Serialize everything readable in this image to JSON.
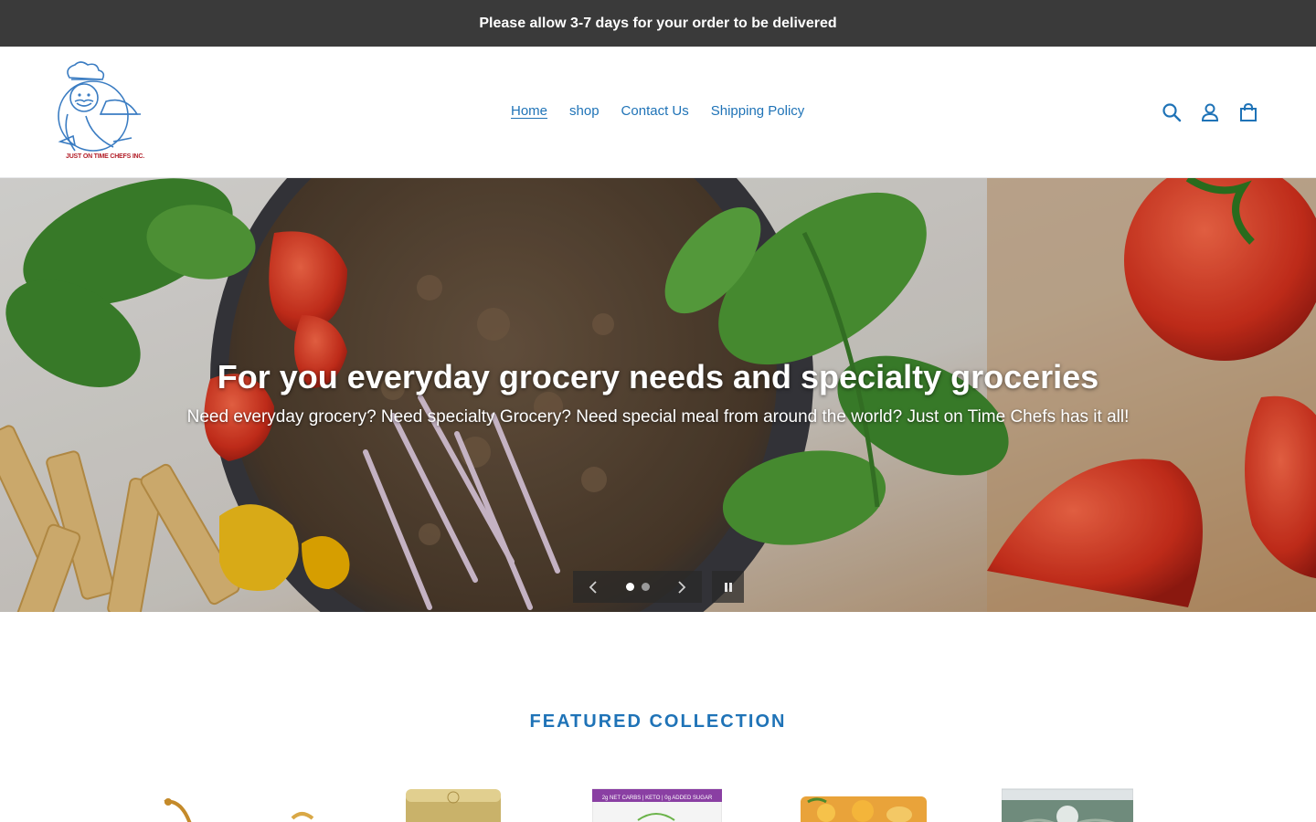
{
  "announcement": {
    "text": "Please allow 3-7 days for your order to be delivered"
  },
  "header": {
    "logo_text": "JUST ON TIME CHEFS INC.",
    "nav": [
      {
        "label": "Home",
        "active": true
      },
      {
        "label": "shop",
        "active": false
      },
      {
        "label": "Contact Us",
        "active": false
      },
      {
        "label": "Shipping Policy",
        "active": false
      }
    ],
    "icons": [
      "search-icon",
      "account-icon",
      "cart-icon"
    ]
  },
  "hero": {
    "title": "For you everyday grocery needs and specialty groceries",
    "subtitle": "Need everyday grocery? Need specialty Grocery? Need special meal from around the world? Just on Time Chefs has it all!",
    "slides_total": 2,
    "active_slide": 1
  },
  "featured": {
    "heading": "FEATURED COLLECTION",
    "product_labels": [
      "2g NET CARBS | KETO | 0g ADDED SUGAR"
    ]
  },
  "colors": {
    "accent": "#1f73b7",
    "announcement_bg": "#3a3a3a",
    "text": "#3a3a3a"
  }
}
